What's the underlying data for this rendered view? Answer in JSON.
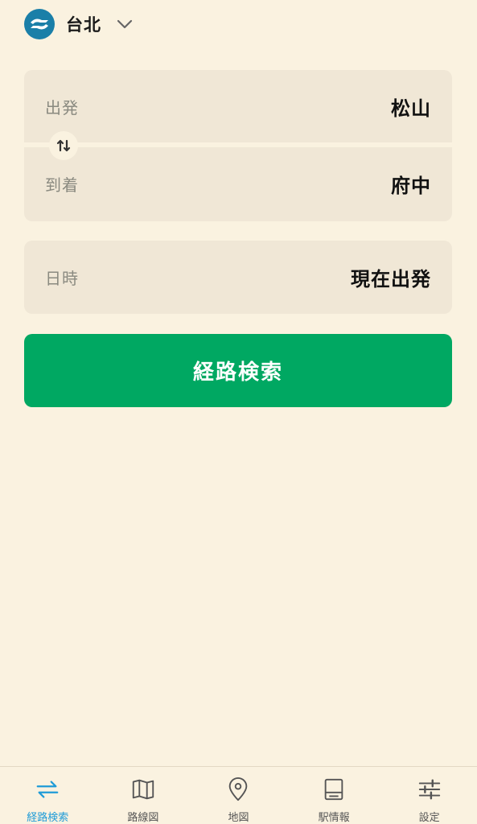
{
  "header": {
    "city": "台北",
    "logo_icon": "metro-logo-icon",
    "accent_color": "#1A7FA8"
  },
  "route_form": {
    "departure_label": "出発",
    "departure_value": "松山",
    "arrival_label": "到着",
    "arrival_value": "府中",
    "swap_icon": "swap-vertical-icon"
  },
  "datetime": {
    "label": "日時",
    "value": "現在出発"
  },
  "search_button": {
    "label": "経路検索",
    "color": "#00A862"
  },
  "bottom_nav": {
    "items": [
      {
        "label": "経路検索",
        "icon": "route-search-icon",
        "active": true
      },
      {
        "label": "路線図",
        "icon": "map-book-icon",
        "active": false
      },
      {
        "label": "地図",
        "icon": "location-pin-icon",
        "active": false
      },
      {
        "label": "駅情報",
        "icon": "station-info-icon",
        "active": false
      },
      {
        "label": "設定",
        "icon": "settings-sliders-icon",
        "active": false
      }
    ],
    "active_color": "#1E9BD7"
  }
}
